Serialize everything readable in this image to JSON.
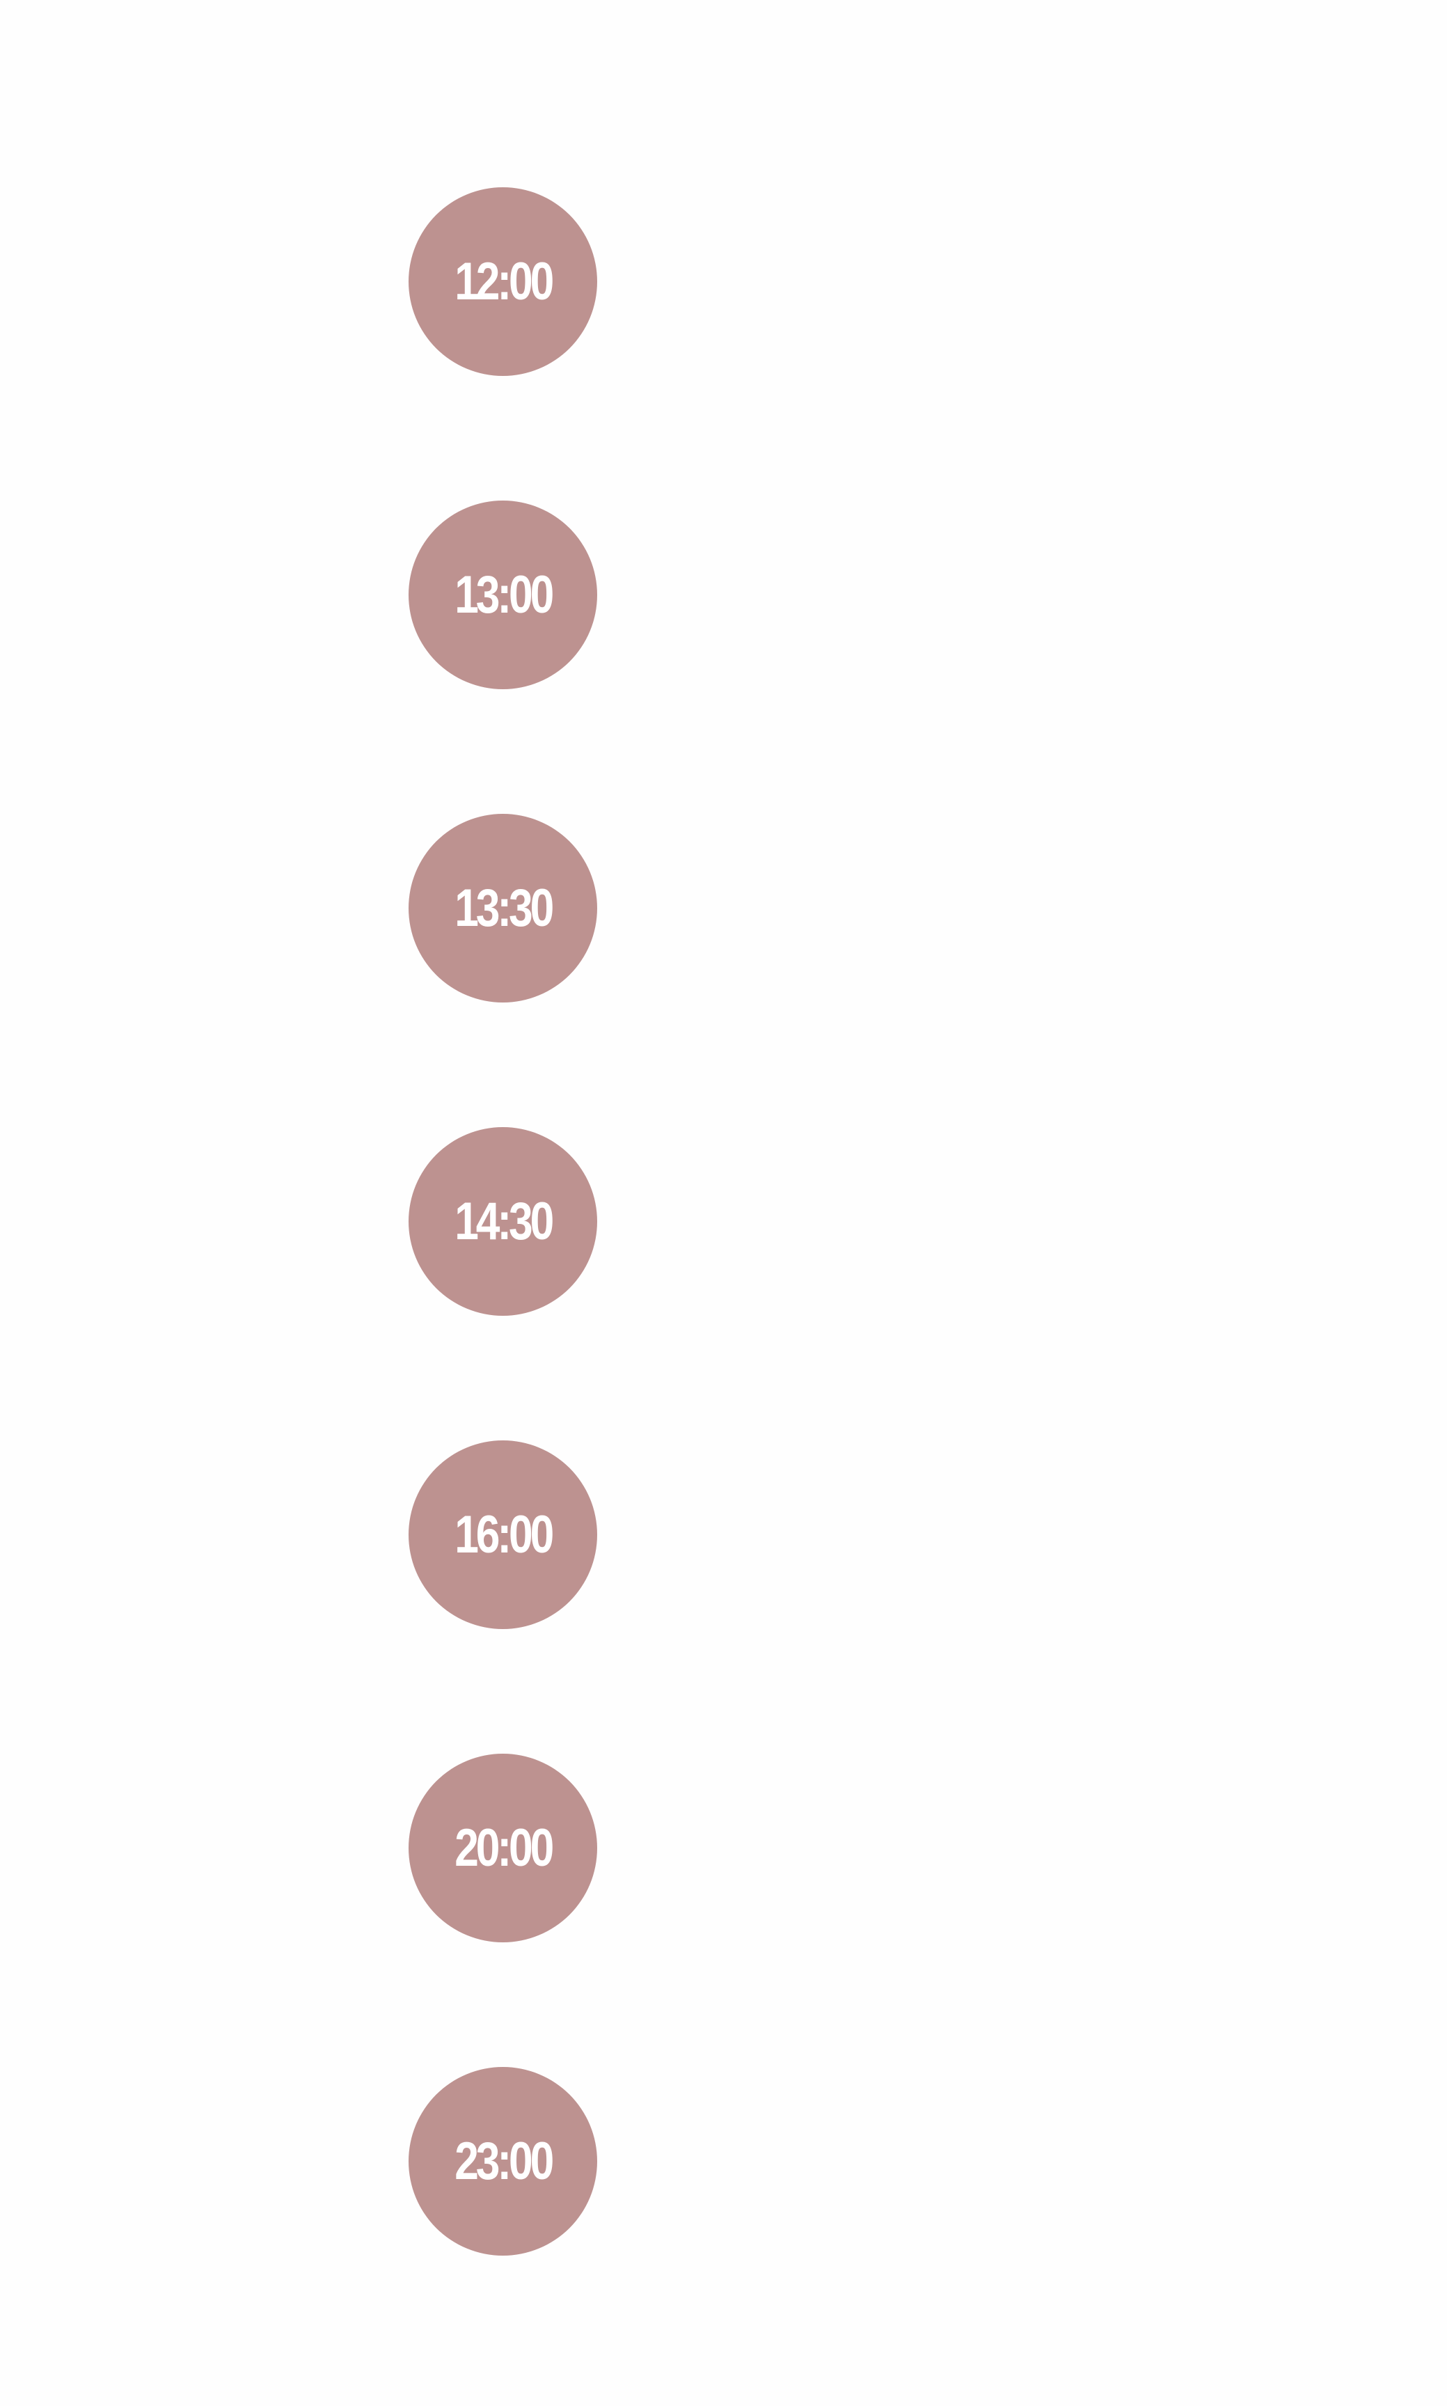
{
  "colors": {
    "background": "#fefefe",
    "badge": "#bd9290",
    "badge_text": "#ffffff"
  },
  "timeline": {
    "items": [
      {
        "label": "12:00"
      },
      {
        "label": "13:00"
      },
      {
        "label": "13:30"
      },
      {
        "label": "14:30"
      },
      {
        "label": "16:00"
      },
      {
        "label": "20:00"
      },
      {
        "label": "23:00"
      }
    ]
  }
}
